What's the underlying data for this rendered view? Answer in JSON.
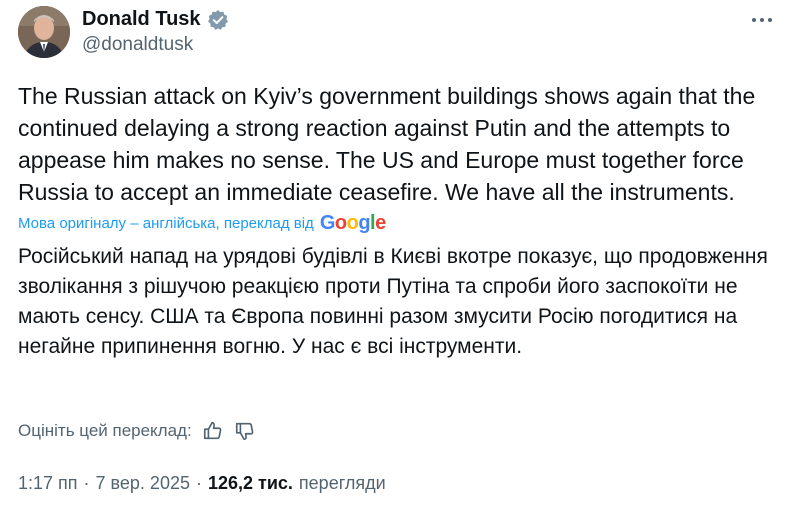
{
  "author": {
    "name": "Donald Tusk",
    "handle": "@donaldtusk",
    "verified_color": "#829aab"
  },
  "tweet": {
    "text": "The Russian attack on Kyiv’s government buildings shows again that the continued delaying a strong reaction against Putin and the attempts to appease him makes no sense. The US and Europe must together force Russia to accept an immediate ceasefire. We have all the instruments."
  },
  "translation": {
    "label": "Мова оригіналу – англійська, переклад від",
    "provider": "Google",
    "text": "Російський напад на урядові будівлі в Києві вкотре показує, що продовження зволікання з рішучою реакцією проти Путіна та спроби його заспокоїти не мають сенсу. США та Європа повинні разом змусити Росію погодитися на негайне припинення вогню. У нас є всі інструменти.",
    "rate_label": "Оцініть цей переклад:"
  },
  "meta": {
    "time": "1:17 пп",
    "date": "7 вер. 2025",
    "views_count": "126,2 тис.",
    "views_label": "перегляди"
  },
  "icons": {
    "more": "more-dots-icon",
    "verified": "verified-badge-icon",
    "thumb_up": "thumb-up-icon",
    "thumb_down": "thumb-down-icon"
  },
  "colors": {
    "link": "#1d9bf0",
    "secondary_text": "#536471",
    "primary_text": "#0f1419"
  }
}
